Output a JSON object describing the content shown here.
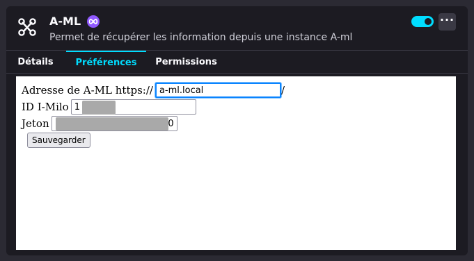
{
  "addon": {
    "title": "A-ML",
    "description": "Permet de récupérer les information depuis une instance A-ml",
    "enabled": true,
    "icon": "share-nodes-icon",
    "badge_icon": "infinity-icon",
    "more_label": "···"
  },
  "tabs": [
    {
      "label": "Détails"
    },
    {
      "label": "Préférences"
    },
    {
      "label": "Permissions"
    }
  ],
  "active_tab": "Préférences",
  "prefs": {
    "url_label": "Adresse de A-ML https://",
    "url_suffix": "/",
    "url_value": "a-ml.local",
    "id_label": "ID I-Milo",
    "id_value": "1",
    "token_label": "Jeton",
    "token_value": "0",
    "save_label": "Sauvegarder"
  }
}
